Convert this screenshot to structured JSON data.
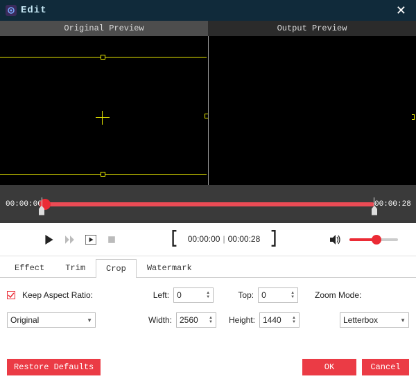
{
  "window": {
    "title": "Edit"
  },
  "preview": {
    "original_label": "Original Preview",
    "output_label": "Output Preview"
  },
  "timeline": {
    "start_time": "00:00:00",
    "end_time": "00:00:28"
  },
  "playback": {
    "current_time": "00:00:00",
    "total_time": "00:00:28"
  },
  "tabs": {
    "effect": "Effect",
    "trim": "Trim",
    "crop": "Crop",
    "watermark": "Watermark",
    "active": "crop"
  },
  "crop": {
    "keep_aspect_label": "Keep Aspect Ratio:",
    "keep_aspect_checked": true,
    "left_label": "Left:",
    "left_value": "0",
    "top_label": "Top:",
    "top_value": "0",
    "width_label": "Width:",
    "width_value": "2560",
    "height_label": "Height:",
    "height_value": "1440",
    "zoom_mode_label": "Zoom Mode:",
    "aspect_select": "Original",
    "zoom_select": "Letterbox"
  },
  "buttons": {
    "restore": "Restore Defaults",
    "ok": "OK",
    "cancel": "Cancel"
  }
}
